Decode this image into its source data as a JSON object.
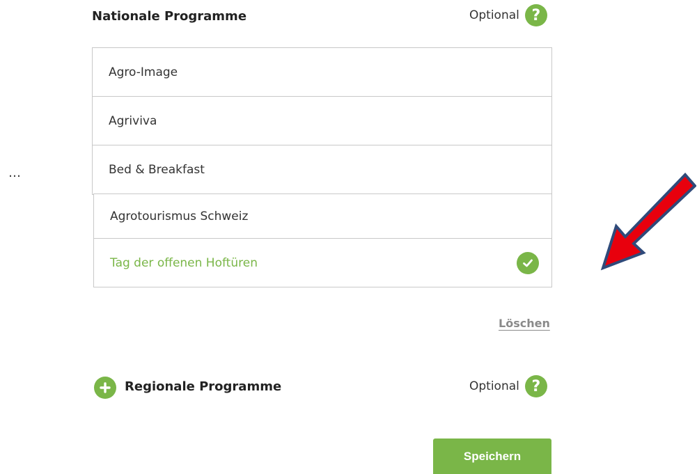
{
  "national": {
    "title": "Nationale Programme",
    "optional_label": "Optional",
    "help_glyph": "?",
    "items": [
      {
        "label": "Agro-Image",
        "selected": false
      },
      {
        "label": "Agriviva",
        "selected": false
      },
      {
        "label": "Bed & Breakfast",
        "selected": false
      },
      {
        "label": "Agrotourismus Schweiz",
        "selected": false
      },
      {
        "label": "Tag der offenen Hoftüren",
        "selected": true
      }
    ]
  },
  "ellipsis": "…",
  "delete_label": "Löschen",
  "regional": {
    "title": "Regionale Programme",
    "optional_label": "Optional",
    "help_glyph": "?"
  },
  "save_label": "Speichern",
  "colors": {
    "accent": "#7ab648",
    "arrow_fill": "#e8000d",
    "arrow_outline": "#2f4a7a"
  },
  "icons": {
    "help": "help-icon",
    "check": "check-circle-icon",
    "add": "plus-circle-icon",
    "annotation": "red-arrow-annotation"
  }
}
